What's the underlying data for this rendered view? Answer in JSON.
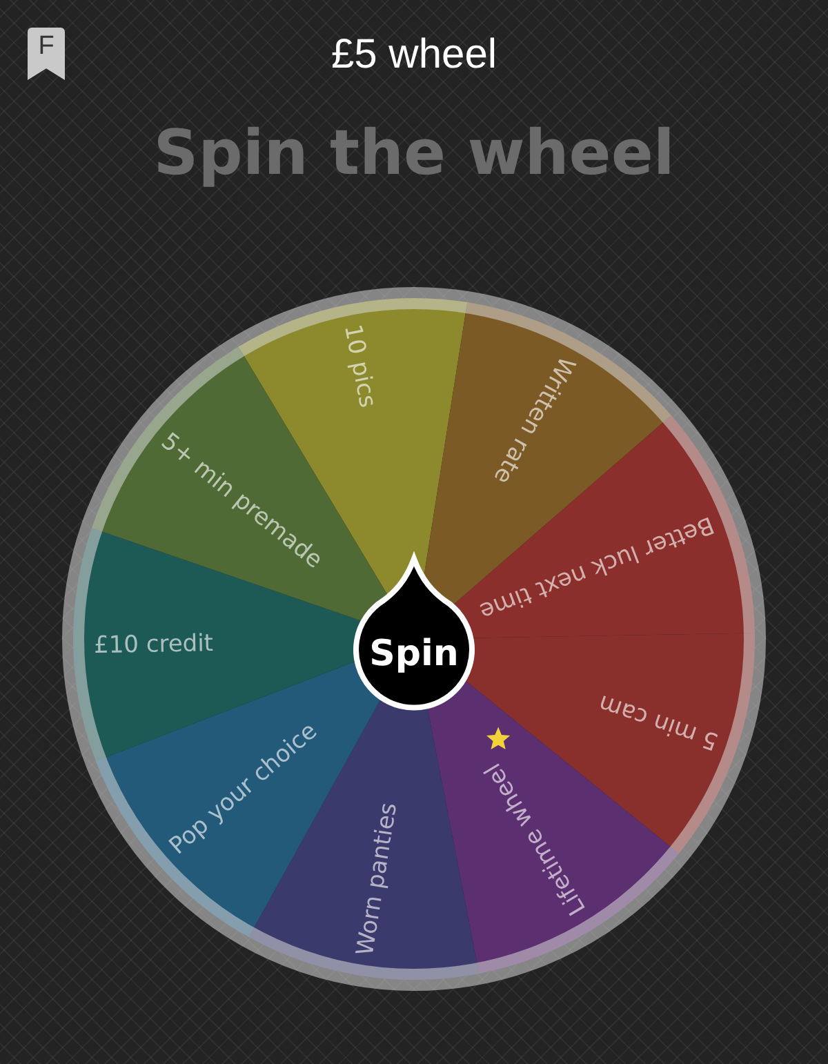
{
  "header": {
    "badge": "F",
    "title": "£5 wheel"
  },
  "heading": "Spin the wheel",
  "wheel": {
    "button": "Spin",
    "segments": [
      {
        "label": "10 pics",
        "color": "#8c8a2c",
        "starred": false
      },
      {
        "label": "Written rate",
        "color": "#7c5a26",
        "starred": false
      },
      {
        "label": "Better luck next time",
        "color": "#8a2f2b",
        "starred": false
      },
      {
        "label": "5 min cam",
        "color": "#8a302c",
        "starred": false
      },
      {
        "label": "Lifetime wheel",
        "color": "#5c2f70",
        "starred": true
      },
      {
        "label": "Worn panties",
        "color": "#3b3a6c",
        "starred": false
      },
      {
        "label": "Pop your choice",
        "color": "#235a7a",
        "starred": false
      },
      {
        "label": "£10 credit",
        "color": "#1e5a55",
        "starred": false
      },
      {
        "label": "5+ min premade",
        "color": "#4f6a35",
        "starred": false
      }
    ]
  }
}
